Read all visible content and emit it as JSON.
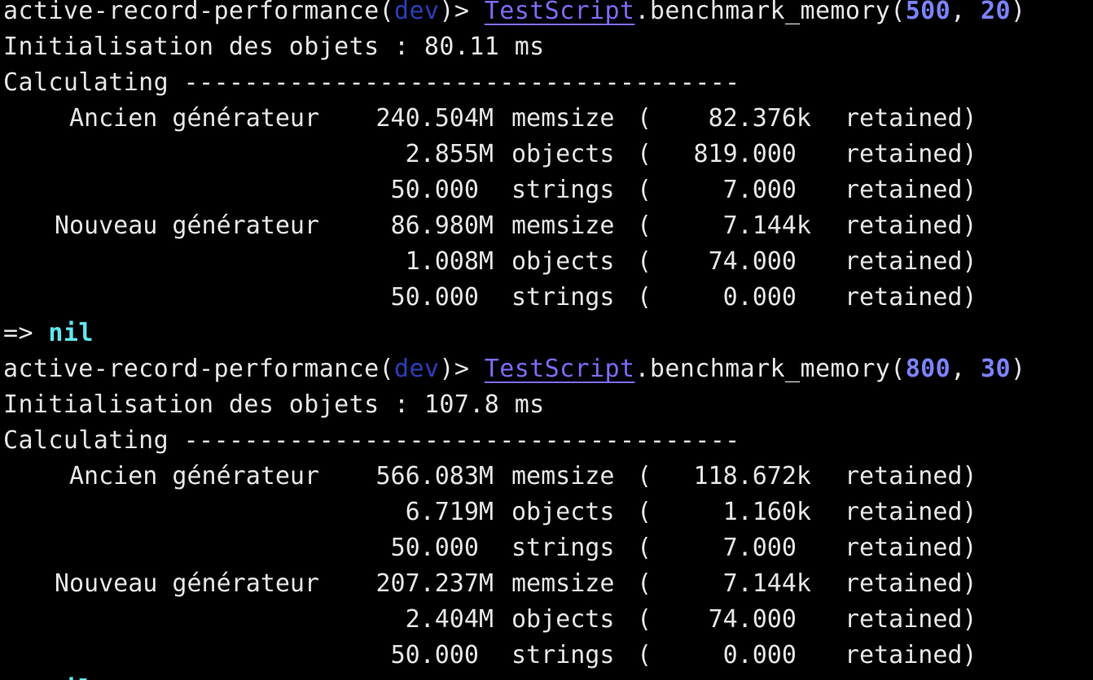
{
  "session": {
    "prompt_prefix": "active-record-performance(",
    "env": "dev",
    "prompt_suffix": ")> ",
    "const": "TestScript",
    "method": ".benchmark_memory(",
    "comma": ", ",
    "close": ")"
  },
  "runs": [
    {
      "arg1": "500",
      "arg2": "20",
      "init_line": "Initialisation des objets : 80.11 ms",
      "calc_line": "Calculating -------------------------------------",
      "rows": [
        {
          "label": "Ancien générateur",
          "value": "240.504M",
          "unit": "memsize",
          "retained": "82.376k",
          "rword": "retained)"
        },
        {
          "label": "",
          "value": "2.855M",
          "unit": "objects",
          "retained": "819.000 ",
          "rword": "retained)"
        },
        {
          "label": "",
          "value": "50.000 ",
          "unit": "strings",
          "retained": "7.000 ",
          "rword": "retained)"
        },
        {
          "label": "Nouveau générateur",
          "value": "86.980M",
          "unit": "memsize",
          "retained": "7.144k",
          "rword": "retained)"
        },
        {
          "label": "",
          "value": "1.008M",
          "unit": "objects",
          "retained": "74.000 ",
          "rword": "retained)"
        },
        {
          "label": "",
          "value": "50.000 ",
          "unit": "strings",
          "retained": "0.000 ",
          "rword": "retained)"
        }
      ],
      "result_arrow": "=> ",
      "result_value": "nil"
    },
    {
      "arg1": "800",
      "arg2": "30",
      "init_line": "Initialisation des objets : 107.8 ms",
      "calc_line": "Calculating -------------------------------------",
      "rows": [
        {
          "label": "Ancien générateur",
          "value": "566.083M",
          "unit": "memsize",
          "retained": "118.672k",
          "rword": "retained)"
        },
        {
          "label": "",
          "value": "6.719M",
          "unit": "objects",
          "retained": "1.160k",
          "rword": "retained)"
        },
        {
          "label": "",
          "value": "50.000 ",
          "unit": "strings",
          "retained": "7.000 ",
          "rword": "retained)"
        },
        {
          "label": "Nouveau générateur",
          "value": "207.237M",
          "unit": "memsize",
          "retained": "7.144k",
          "rword": "retained)"
        },
        {
          "label": "",
          "value": "2.404M",
          "unit": "objects",
          "retained": "74.000 ",
          "rword": "retained)"
        },
        {
          "label": "",
          "value": "50.000 ",
          "unit": "strings",
          "retained": "0.000 ",
          "rword": "retained)"
        }
      ],
      "result_arrow": "=> ",
      "result_value": "nil"
    }
  ],
  "paren_open": "(",
  "colors": {
    "background": "#000000",
    "text": "#e6e6e6",
    "env": "#2b3fb8",
    "constant": "#7b6cf6",
    "number": "#7b83ff",
    "nil": "#5fe6f0"
  }
}
